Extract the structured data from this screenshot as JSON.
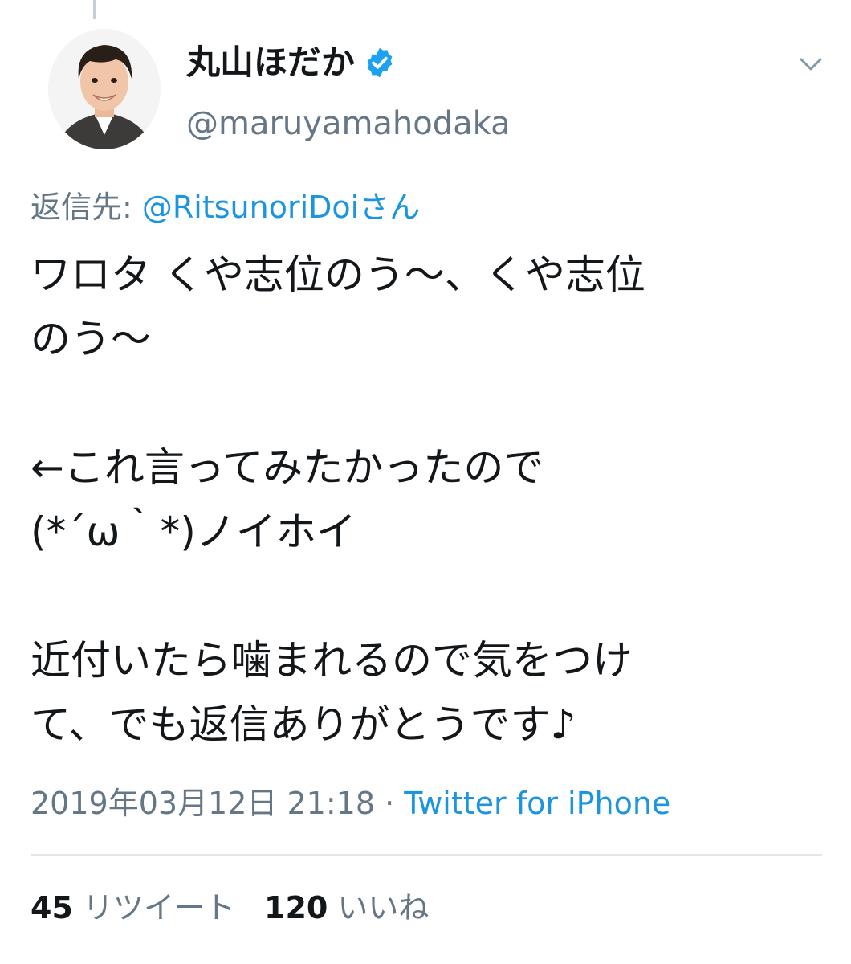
{
  "user": {
    "display_name": "丸山ほだか",
    "handle": "@maruyamahodaka",
    "verified": true
  },
  "reply": {
    "label": "返信先: ",
    "mention": "@RitsunoriDoiさん"
  },
  "tweet": {
    "text": "ワロタ くや志位のう〜、くや志位\nのう〜\n\n←これ言ってみたかったので\n(*´ω｀*)ノイホイ\n\n近付いたら噛まれるので気をつけ\nて、でも返信ありがとうです♪",
    "timestamp": "2019年03月12日 21:18",
    "separator": " · ",
    "source": "Twitter for iPhone"
  },
  "stats": {
    "retweet_count": "45",
    "retweet_label": "リツイート",
    "like_count": "120",
    "like_label": "いいね"
  },
  "colors": {
    "link": "#1b95e0",
    "secondary": "#657786",
    "verified_badge": "#1da1f2"
  },
  "icons": {
    "verified": "verified-badge-icon",
    "menu": "chevron-down-icon"
  }
}
